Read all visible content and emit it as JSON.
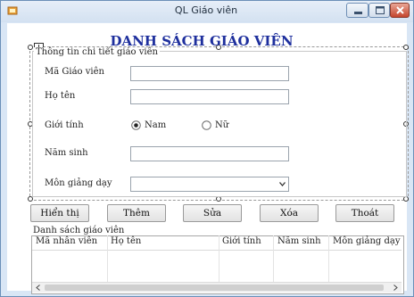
{
  "window": {
    "title": "QL Giáo viên"
  },
  "heading": "DANH SÁCH GIÁO VIÊN",
  "detail_group": {
    "title": "Thông tin chi tiết giáo viên",
    "fields": {
      "ma_gv": {
        "label": "Mã Giáo viên",
        "value": ""
      },
      "ho_ten": {
        "label": "Họ tên",
        "value": ""
      },
      "gioi_tinh": {
        "label": "Giới tính",
        "options": [
          "Nam",
          "Nữ"
        ],
        "selected": "Nam"
      },
      "nam_sinh": {
        "label": "Năm sinh",
        "value": ""
      },
      "mon_giang_day": {
        "label": "Môn giảng dạy",
        "value": ""
      }
    }
  },
  "buttons": {
    "show": "Hiển thị",
    "add": "Thêm",
    "edit": "Sửa",
    "delete": "Xóa",
    "exit": "Thoát"
  },
  "list_group": {
    "title": "Danh sách giáo viên",
    "columns": [
      "Mã nhân viên",
      "Họ tên",
      "Giới tính",
      "Năm sinh",
      "Môn giảng dạy"
    ]
  }
}
